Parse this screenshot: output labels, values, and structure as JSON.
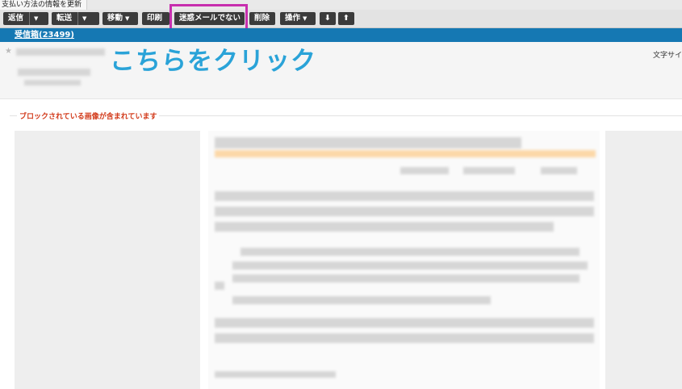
{
  "tab": {
    "title": "支払い方法の情報を更新"
  },
  "toolbar": {
    "reply": "返信",
    "forward": "転送",
    "move": "移動",
    "print": "印刷",
    "not_spam": "迷惑メールでない",
    "delete": "削除",
    "actions": "操作",
    "down_arrow": "⬇",
    "up_arrow": "⬆"
  },
  "folder": {
    "label": "受信箱(23499)"
  },
  "annotation": {
    "text": "こちらをクリック"
  },
  "header": {
    "text_size_label": "文字サイ"
  },
  "notice": {
    "blocked_images": "ブロックされている画像が含まれています"
  },
  "colors": {
    "highlight": "#c72fae",
    "folder_bar": "#1578b3",
    "annotation": "#2aa3d8",
    "notice": "#d23a1a"
  }
}
